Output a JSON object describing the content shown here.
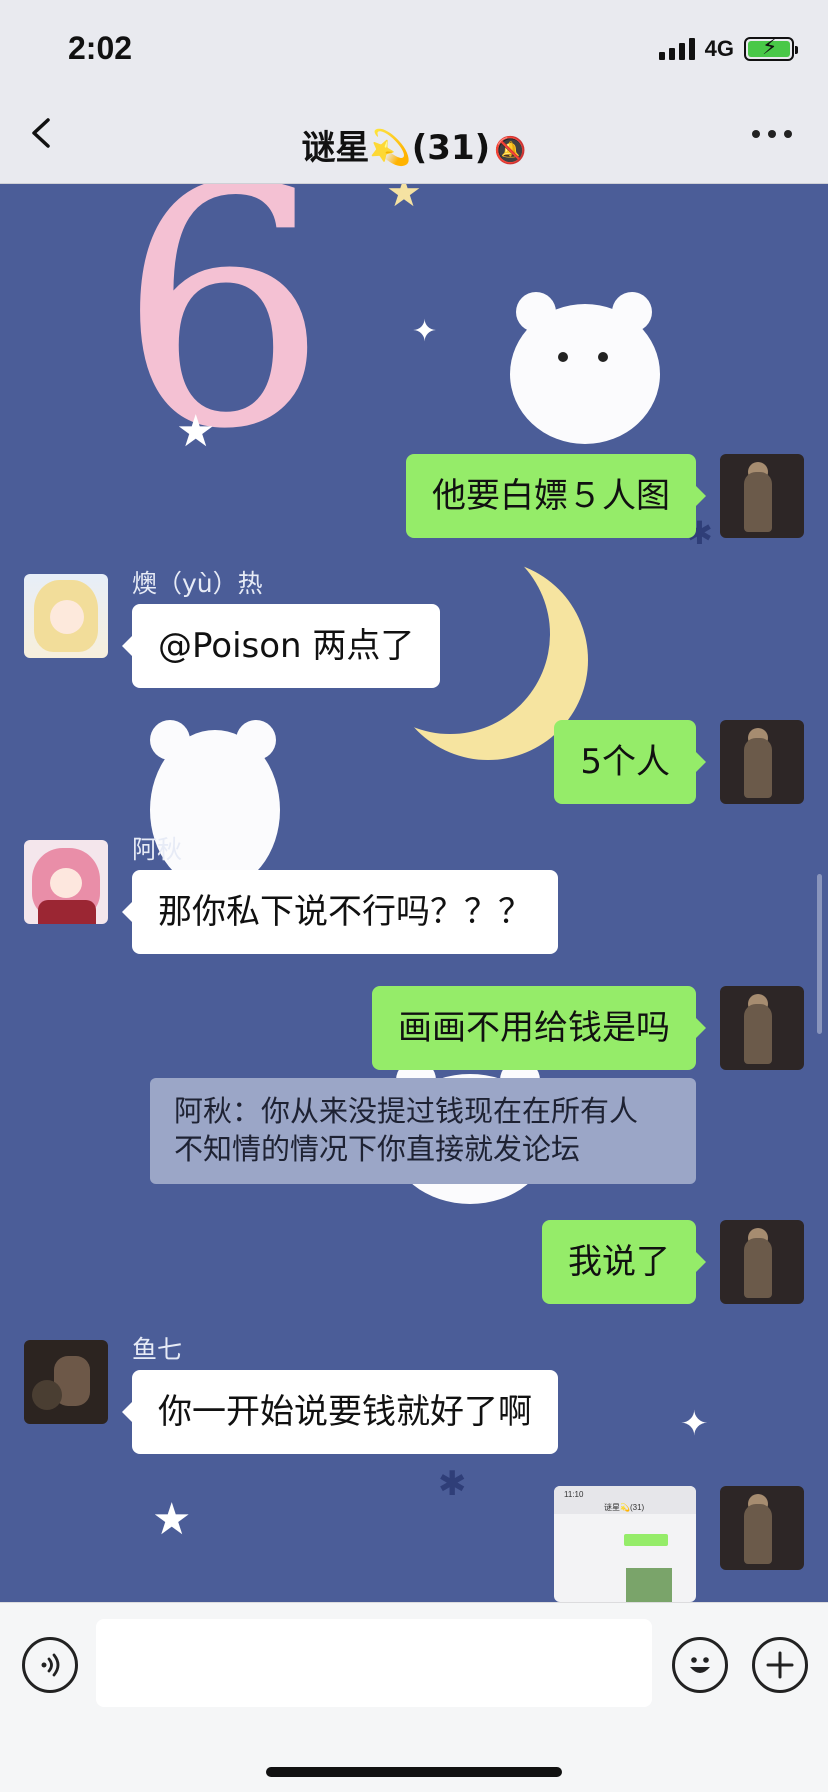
{
  "status_bar": {
    "time": "2:02",
    "network": "4G"
  },
  "header": {
    "title": "谜星💫(31)",
    "mute_icon": "🔕"
  },
  "messages": [
    {
      "sender": "self",
      "text": "他要白嫖５人图"
    },
    {
      "sender": "燠（yù）热",
      "text": "@Poison 两点了"
    },
    {
      "sender": "self",
      "text": "5个人"
    },
    {
      "sender": "阿秋",
      "text": "那你私下说不行吗？？？"
    },
    {
      "sender": "self",
      "text": "画画不用给钱是吗"
    },
    {
      "sender": "self",
      "text": "我说了"
    },
    {
      "sender": "鱼七",
      "text": "你一开始说要钱就好了啊"
    },
    {
      "sender": "self",
      "type": "image"
    }
  ],
  "quote": {
    "line1": "阿秋：你从来没提过钱现在在所有人",
    "line2": "不知情的情况下你直接就发论坛"
  },
  "thumbnail": {
    "time": "11:10",
    "title": "谜星💫(31)"
  },
  "icons": {
    "back": "chevron-left-icon",
    "more": "more-dots-icon",
    "voice": "voice-icon",
    "emoji": "emoji-icon",
    "plus": "plus-icon"
  },
  "colors": {
    "outgoing_bubble": "#95ec69",
    "incoming_bubble": "#ffffff",
    "chat_bg": "#4b5d98"
  }
}
